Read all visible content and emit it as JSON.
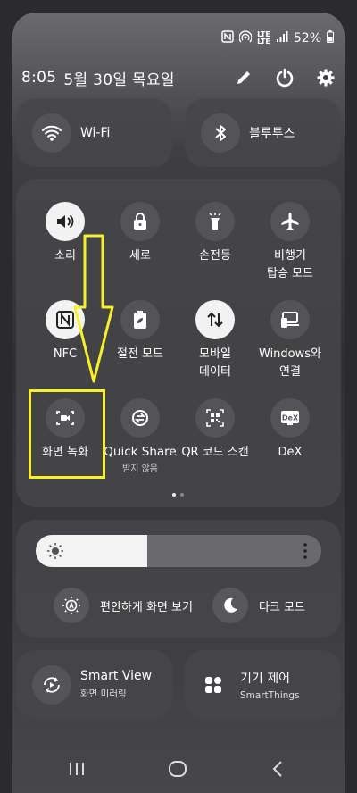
{
  "status": {
    "lte_top": "LTE",
    "lte_bottom": "LTE",
    "battery": "52%"
  },
  "header": {
    "time": "8:05",
    "date": "5월 30일 목요일"
  },
  "wifi": {
    "label": "Wi-Fi"
  },
  "bluetooth": {
    "label": "블루투스"
  },
  "tiles": [
    {
      "label": "소리",
      "sub": ""
    },
    {
      "label": "세로",
      "sub": ""
    },
    {
      "label": "손전등",
      "sub": ""
    },
    {
      "label": "비행기\n탑승 모드",
      "sub": ""
    },
    {
      "label": "NFC",
      "sub": ""
    },
    {
      "label": "절전 모드",
      "sub": ""
    },
    {
      "label": "모바일\n데이터",
      "sub": ""
    },
    {
      "label": "Windows와\n연결",
      "sub": ""
    },
    {
      "label": "화면 녹화",
      "sub": ""
    },
    {
      "label": "Quick Share",
      "sub": "받지 않음"
    },
    {
      "label": "QR 코드 스캔",
      "sub": ""
    },
    {
      "label": "DeX",
      "sub": ""
    }
  ],
  "brightness": {
    "level": 0.39
  },
  "eye_comfort": {
    "label": "편안하게 화면 보기"
  },
  "dark_mode": {
    "label": "다크 모드"
  },
  "smart_view": {
    "title": "Smart View",
    "sub": "화면 미러링"
  },
  "device_control": {
    "title": "기기 제어",
    "sub": "SmartThings"
  },
  "dex_badge": "DeX",
  "icons": [
    "nfc-icon",
    "hotspot-icon",
    "signal-icon",
    "battery-icon",
    "edit-icon",
    "power-icon",
    "settings-icon"
  ],
  "colors": {
    "highlight": "#f5f02a",
    "tile_on": "#f2f2f2",
    "tile_off": "#545458"
  }
}
